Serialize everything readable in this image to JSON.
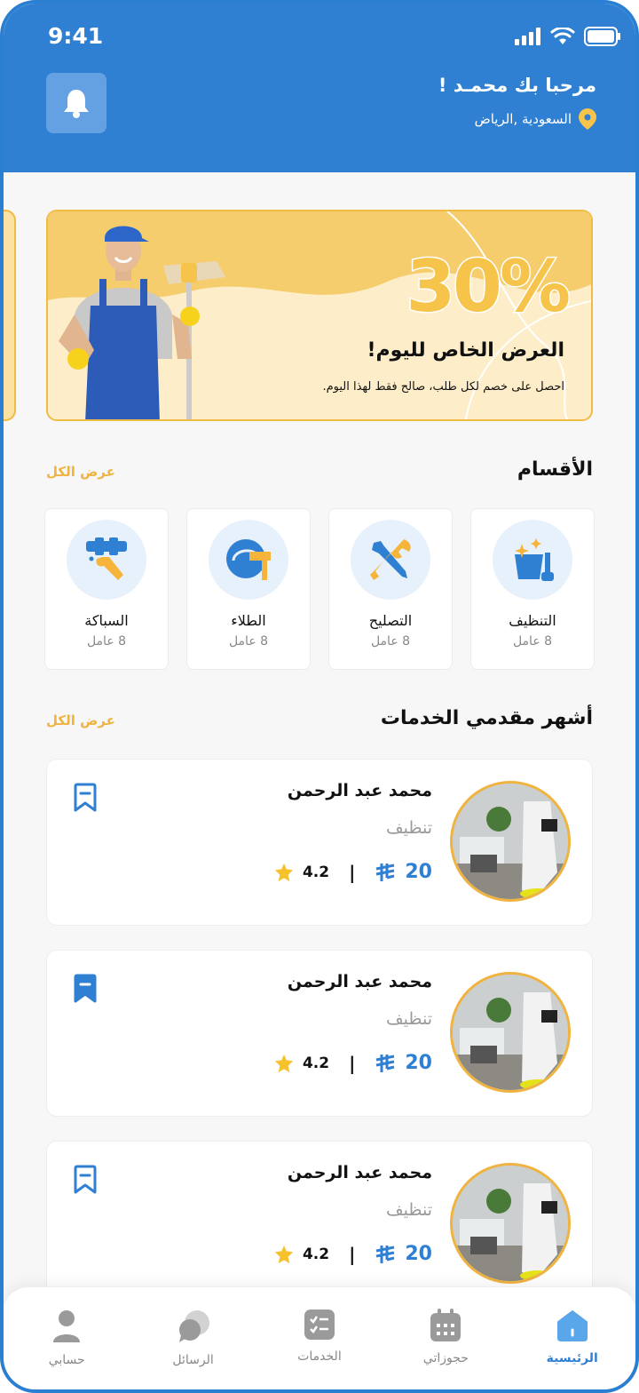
{
  "status": {
    "time": "9:41"
  },
  "header": {
    "greeting": "مرحبا بك محمـد !",
    "location": "السعودية ,الرياض"
  },
  "banner": {
    "percent": "30%",
    "title": "العرض الخاص لليوم!",
    "description": "احصل على خصم لكل طلب، صالح فقط لهذا اليوم."
  },
  "categories": {
    "title": "الأقسام",
    "see_all": "عرض الكل",
    "items": [
      {
        "name": "التنظيف",
        "count": "8 عامل",
        "icon": "cleaning-icon"
      },
      {
        "name": "التصليح",
        "count": "8 عامل",
        "icon": "repair-tools-icon"
      },
      {
        "name": "الطلاء",
        "count": "8 عامل",
        "icon": "paint-bucket-icon"
      },
      {
        "name": "السباكة",
        "count": "8 عامل",
        "icon": "plumbing-icon"
      }
    ]
  },
  "providers": {
    "title": "أشهر مقدمي الخدمات",
    "see_all": "عرض الكل",
    "items": [
      {
        "name": "محمد عبد الرحمن",
        "category": "تنظيف",
        "price": "20",
        "rating": "4.2",
        "bookmarked": false
      },
      {
        "name": "محمد عبد الرحمن",
        "category": "تنظيف",
        "price": "20",
        "rating": "4.2",
        "bookmarked": true
      },
      {
        "name": "محمد عبد الرحمن",
        "category": "تنظيف",
        "price": "20",
        "rating": "4.2",
        "bookmarked": false
      }
    ]
  },
  "nav": {
    "items": [
      {
        "label": "الرئيسية",
        "icon": "home-icon",
        "active": true
      },
      {
        "label": "حجوزاتي",
        "icon": "calendar-icon",
        "active": false
      },
      {
        "label": "الخدمات",
        "icon": "services-list-icon",
        "active": false
      },
      {
        "label": "الرسائل",
        "icon": "chat-icon",
        "active": false
      },
      {
        "label": "حسابي",
        "icon": "profile-icon",
        "active": false
      }
    ]
  },
  "colors": {
    "primary": "#2f7fd3",
    "accent": "#f0b33f",
    "banner": "#fdeec9"
  }
}
